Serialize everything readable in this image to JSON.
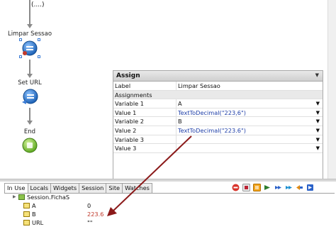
{
  "flow": {
    "top_label": "(....)",
    "nodes": [
      {
        "label": "Limpar Sessao",
        "icon": "assign-icon"
      },
      {
        "label": "Set URL",
        "icon": "execute-icon"
      },
      {
        "label": "End",
        "icon": "end-icon"
      }
    ]
  },
  "assign_panel": {
    "title": "Assign",
    "rows": [
      {
        "key": "Label",
        "value": "Limpar Sessao",
        "dropdown": false
      },
      {
        "key": "Assignments",
        "value": "",
        "section": true
      },
      {
        "key": "Variable 1",
        "value": "A",
        "dropdown": true
      },
      {
        "key": "Value 1",
        "value": "TextToDecimal(\"223,6\")",
        "dropdown": true,
        "fn": true
      },
      {
        "key": "Variable 2",
        "value": "B",
        "dropdown": true
      },
      {
        "key": "Value 2",
        "value": "TextToDecimal(\"223.6\")",
        "dropdown": true,
        "fn": true
      },
      {
        "key": "Variable 3",
        "value": "",
        "dropdown": true
      },
      {
        "key": "Value 3",
        "value": "",
        "dropdown": true
      }
    ]
  },
  "debugger": {
    "tabs": [
      "In Use",
      "Locals",
      "Widgets",
      "Session",
      "Site",
      "Watches"
    ],
    "active_tab": "In Use",
    "toolbar_icons": [
      "stop-icon",
      "pause-icon",
      "continue-icon",
      "step-over-icon",
      "step-into-icon",
      "step-out-icon",
      "run-to-icon",
      "break-icon"
    ],
    "rows": [
      {
        "name": "Session.FichaS",
        "value": "",
        "indent": 0,
        "color": "green",
        "expander": true
      },
      {
        "name": "A",
        "value": "0",
        "indent": 1,
        "color": "yellow"
      },
      {
        "name": "B",
        "value": "223.6",
        "indent": 1,
        "color": "yellow",
        "highlight": true
      },
      {
        "name": "URL",
        "value": "\"\"",
        "indent": 1,
        "color": "yellow"
      }
    ]
  },
  "colors": {
    "annotation": "#8b1a1a",
    "highlight_value": "#c0392b",
    "function_text": "#1f3fa8"
  }
}
